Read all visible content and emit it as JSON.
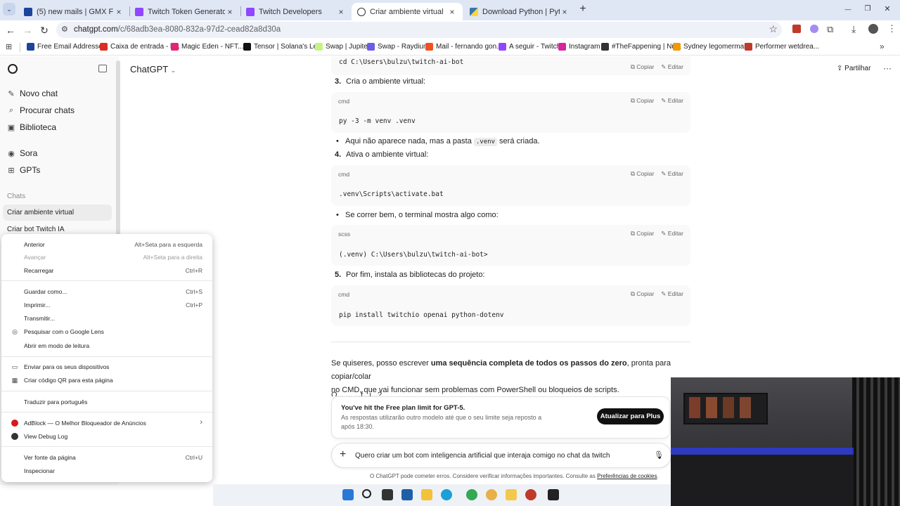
{
  "tabs": [
    {
      "title": "(5) new mails | GMX FreeMail",
      "close": "×"
    },
    {
      "title": "Twitch Token Generator by swif",
      "close": "×"
    },
    {
      "title": "Twitch Developers",
      "close": "×"
    },
    {
      "title": "Criar ambiente virtual",
      "close": "×"
    },
    {
      "title": "Download Python | Python.org",
      "close": "×"
    }
  ],
  "new_tab": "+",
  "window_controls": {
    "minimize": "—",
    "restore": "❐",
    "close": "✕"
  },
  "address": {
    "host": "chatgpt.com",
    "path": "/c/68adb3ea-8080-832a-97d2-cead82a8d30a"
  },
  "bookmarks": [
    {
      "label": "Free Email Addresse...",
      "color": "#1c449b"
    },
    {
      "label": "Caixa de entrada - b...",
      "color": "#d93025"
    },
    {
      "label": "Magic Eden - NFT...",
      "color": "#e42575"
    },
    {
      "label": "Tensor | Solana's Le...",
      "color": "#111111"
    },
    {
      "label": "Swap | Jupiter",
      "color": "#c7f284"
    },
    {
      "label": "Swap - Raydium",
      "color": "#6c5ce7"
    },
    {
      "label": "Mail - fernando gon...",
      "color": "#f25022"
    },
    {
      "label": "A seguir - Twitch",
      "color": "#9146ff"
    },
    {
      "label": "Instagram",
      "color": "#d6249f"
    },
    {
      "label": "#TheFappening | Nu...",
      "color": "#333333"
    },
    {
      "label": "Sydney legomermai...",
      "color": "#f29900"
    },
    {
      "label": "Performer wetdrea...",
      "color": "#c0392b"
    }
  ],
  "sidebar": {
    "items": [
      {
        "label": "Novo chat",
        "icon": "✎"
      },
      {
        "label": "Procurar chats",
        "icon": "⌕"
      },
      {
        "label": "Biblioteca",
        "icon": "▣"
      },
      {
        "label": "Sora",
        "icon": "◉"
      },
      {
        "label": "GPTs",
        "icon": "⊞"
      }
    ],
    "section": "Chats",
    "chats": [
      "Criar ambiente virtual",
      "Criar bot Twitch IA"
    ]
  },
  "header": {
    "title": "ChatGPT",
    "share": "Partilhar",
    "more": "···"
  },
  "code_actions": {
    "copy": "Copiar",
    "edit": "Editar"
  },
  "content": {
    "top_code": "cd C:\\Users\\bulzu\\twitch-ai-bot",
    "step3": {
      "num": "3.",
      "text": "Cria o ambiente virtual:"
    },
    "code3": {
      "lang": "cmd",
      "code": "py -3 -m venv .venv"
    },
    "bullet3": {
      "pre": "Aqui não aparece nada, mas a pasta ",
      "code": ".venv",
      "post": " será criada."
    },
    "step4": {
      "num": "4.",
      "text": "Ativa o ambiente virtual:"
    },
    "code4": {
      "lang": "cmd",
      "code": ".venv\\Scripts\\activate.bat"
    },
    "bullet4": "Se correr bem, o terminal mostra algo como:",
    "code4b": {
      "lang": "scss",
      "code": "(.venv) C:\\Users\\bulzu\\twitch-ai-bot>"
    },
    "step5": {
      "num": "5.",
      "text": "Por fim, instala as bibliotecas do projeto:"
    },
    "code5": {
      "lang": "cmd",
      "code": "pip install twitchio openai python-dotenv"
    },
    "para": {
      "p1": "Se quiseres, posso escrever ",
      "bold": "uma sequência completa de todos os passos do zero",
      "p2": ", pronta para copiar/colar",
      "line2": "no CMD, que vai funcionar sem problemas com PowerShell ou bloqueios de scripts."
    },
    "cut_line": "Q... ... ...f...i...?"
  },
  "limit": {
    "title": "You've hit the Free plan limit for GPT-5.",
    "body1": "As respostas utilizarão outro modelo até que o seu limite seja reposto a",
    "body2": "após 18:30.",
    "button": "Atualizar para Plus"
  },
  "composer": {
    "text": "Quero criar um bot com inteligencia artificial que interaja comigo no chat da twitch",
    "plus": "+",
    "mic": "🎙"
  },
  "disclaimer": {
    "text": "O ChatGPT pode cometer erros. Considere verificar informações importantes. Consulte as ",
    "link": "Preferências de cookies",
    "end": "."
  },
  "context_menu": [
    {
      "label": "Anterior",
      "shortcut": "Alt+Seta para a esquerda",
      "disabled": false
    },
    {
      "label": "Avançar",
      "shortcut": "Alt+Seta para a direita",
      "disabled": true
    },
    {
      "label": "Recarregar",
      "shortcut": "Ctrl+R",
      "disabled": false
    },
    {
      "label": "Guardar como...",
      "shortcut": "Ctrl+S",
      "disabled": false
    },
    {
      "label": "Imprimir...",
      "shortcut": "Ctrl+P",
      "disabled": false
    },
    {
      "label": "Transmitir...",
      "shortcut": "",
      "disabled": false
    },
    {
      "label": "Pesquisar com o Google Lens",
      "shortcut": "",
      "disabled": false
    },
    {
      "label": "Abrir em modo de leitura",
      "shortcut": "",
      "disabled": false
    },
    {
      "label": "Enviar para os seus dispositivos",
      "shortcut": "",
      "disabled": false
    },
    {
      "label": "Criar código QR para esta página",
      "shortcut": "",
      "disabled": false
    },
    {
      "label": "Traduzir para português",
      "shortcut": "",
      "disabled": false
    },
    {
      "label": "AdBlock — O Melhor Bloqueador de Anúncios",
      "shortcut": "›",
      "disabled": false
    },
    {
      "label": "View Debug Log",
      "shortcut": "",
      "disabled": false
    },
    {
      "label": "Ver fonte da página",
      "shortcut": "Ctrl+U",
      "disabled": false
    },
    {
      "label": "Inspecionar",
      "shortcut": "",
      "disabled": false
    }
  ]
}
